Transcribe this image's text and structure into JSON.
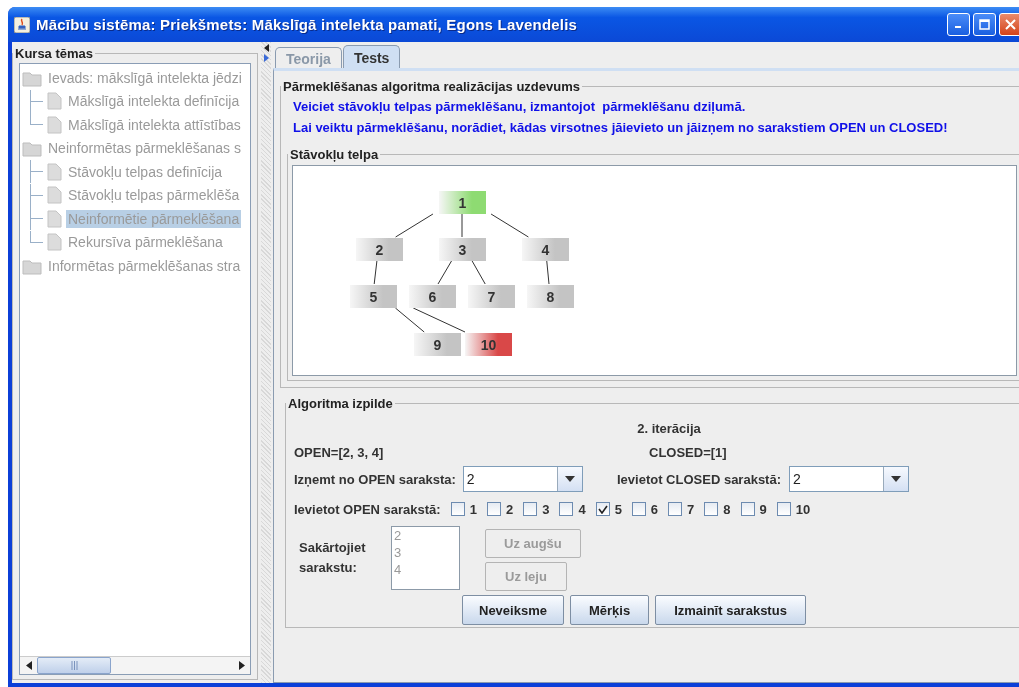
{
  "window": {
    "title": "Mācību sistēma: Priekšmets: Mākslīgā intelekta pamati, Egons Lavendelis"
  },
  "sidebar": {
    "title": "Kursa tēmas",
    "tree": [
      {
        "label": "Ievads: mākslīgā intelekta jēdzi",
        "kind": "folder",
        "selected": false,
        "children": [
          {
            "label": "Mākslīgā intelekta definīcija",
            "selected": false
          },
          {
            "label": "Mākslīgā intelekta attīstības",
            "selected": false
          }
        ]
      },
      {
        "label": "Neinformētas pārmeklēšanas s",
        "kind": "folder",
        "selected": false,
        "children": [
          {
            "label": "Stāvokļu telpas definīcija",
            "selected": false
          },
          {
            "label": "Stāvokļu telpas pārmeklēša",
            "selected": false
          },
          {
            "label": "Neinformētie pārmeklēšana",
            "selected": true
          },
          {
            "label": "Rekursīva pārmeklēšana",
            "selected": false
          }
        ]
      },
      {
        "label": "Informētas pārmeklēšanas stra",
        "kind": "folder",
        "selected": false
      }
    ]
  },
  "tabs": [
    {
      "label": "Teorija",
      "selected": false
    },
    {
      "label": "Tests",
      "selected": true
    }
  ],
  "task": {
    "title": "Pārmeklēšanas algoritma realizācijas uzdevums",
    "instructions": [
      "Veiciet stāvokļu telpas pārmeklēšanu, izmantojot  pārmeklēšanu dziļumā.",
      "Lai veiktu pārmeklēšanu, norādiet, kādas virsotnes jāievieto un jāizņem no sarakstiem OPEN un CLOSED!"
    ]
  },
  "state_space": {
    "title": "Stāvokļu telpa",
    "tree": [
      {
        "label": "1",
        "color": "#8edb72",
        "children": [
          {
            "label": "2",
            "color": "#c4c4c4",
            "children": [
              {
                "label": "5",
                "color": "#c4c4c4",
                "children": [
                  {
                    "label": "9",
                    "color": "#c4c4c4"
                  },
                  {
                    "label": "10",
                    "color": "#d94848"
                  }
                ]
              }
            ]
          },
          {
            "label": "3",
            "color": "#c4c4c4",
            "children": [
              {
                "label": "6",
                "color": "#c4c4c4"
              },
              {
                "label": "7",
                "color": "#c4c4c4"
              }
            ]
          },
          {
            "label": "4",
            "color": "#c4c4c4",
            "children": [
              {
                "label": "8",
                "color": "#c4c4c4"
              }
            ]
          }
        ]
      }
    ]
  },
  "execution": {
    "title": "Algoritma izpilde",
    "iteration": "2. iterācija",
    "open_list": "OPEN=[2, 3, 4]",
    "closed_list": "CLOSED=[1]",
    "remove_label": "Izņemt no OPEN saraksta:",
    "remove_value": "2",
    "closed_label": "Ievietot CLOSED sarakstā:",
    "closed_value": "2",
    "insert_label": "Ievietot OPEN sarakstā:",
    "insert_options": [
      {
        "label": "1",
        "checked": false
      },
      {
        "label": "2",
        "checked": false
      },
      {
        "label": "3",
        "checked": false
      },
      {
        "label": "4",
        "checked": false
      },
      {
        "label": "5",
        "checked": true
      },
      {
        "label": "6",
        "checked": false
      },
      {
        "label": "7",
        "checked": false
      },
      {
        "label": "8",
        "checked": false
      },
      {
        "label": "9",
        "checked": false
      },
      {
        "label": "10",
        "checked": false
      }
    ],
    "sort_label": "Sakārtojiet sarakstu:",
    "sort_items": [
      "2",
      "3",
      "4"
    ],
    "sort_buttons": [
      {
        "label": "Uz augšu",
        "disabled": true
      },
      {
        "label": "Uz leju",
        "disabled": true
      }
    ],
    "actions": [
      "Neveiksme",
      "Mērķis",
      "Izmainīt sarakstus"
    ]
  }
}
